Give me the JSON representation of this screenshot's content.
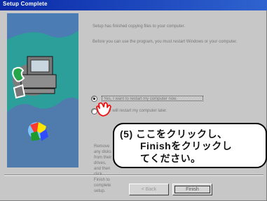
{
  "window": {
    "title": "Setup Complete"
  },
  "content": {
    "paragraph_1": "Setup has finished copying files to your computer.",
    "paragraph_2": "Before you can use the program, you must restart Windows or your computer.",
    "option_1": "Yes, I want to restart my computer now.",
    "option_2": "No, I will restart my computer later.",
    "note": "Remove any disks from their drives, and then click Finish to complete setup."
  },
  "callout": {
    "line_1": "(5) ここをクリックし、",
    "line_2": "Finishをクリックし",
    "line_3": "てください。"
  },
  "buttons": {
    "back_label": "< Back",
    "finish_label": "Finish"
  },
  "colors": {
    "titlebar_start": "#0a2aa8",
    "titlebar_end": "#2f63cf",
    "art_background": "#2c9f9b"
  }
}
